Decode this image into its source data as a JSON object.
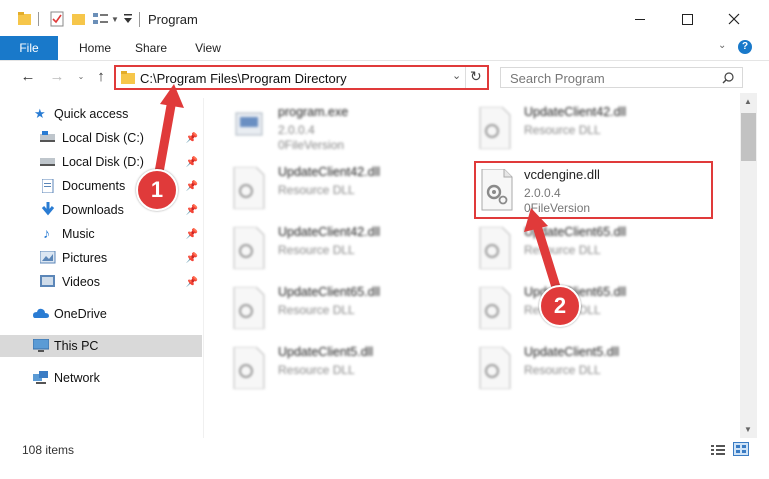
{
  "window": {
    "title": "Program"
  },
  "ribbon": {
    "tabs": [
      "File",
      "Home",
      "Share",
      "View"
    ]
  },
  "address": {
    "path": "C:\\Program Files\\Program Directory"
  },
  "search": {
    "placeholder": "Search Program"
  },
  "sidebar": {
    "items": [
      {
        "label": "Quick access",
        "icon": "star-icon"
      },
      {
        "label": "Local Disk (C:)",
        "icon": "drive-icon"
      },
      {
        "label": "Local Disk (D:)",
        "icon": "drive-icon"
      },
      {
        "label": "Documents",
        "icon": "documents-icon"
      },
      {
        "label": "Downloads",
        "icon": "download-icon"
      },
      {
        "label": "Music",
        "icon": "music-icon"
      },
      {
        "label": "Pictures",
        "icon": "pictures-icon"
      },
      {
        "label": "Videos",
        "icon": "videos-icon"
      },
      {
        "label": "OneDrive",
        "icon": "cloud-icon"
      },
      {
        "label": "This PC",
        "icon": "computer-icon"
      },
      {
        "label": "Network",
        "icon": "network-icon"
      }
    ]
  },
  "files": [
    {
      "name": "program.exe",
      "line2": "2.0.0.4",
      "line3": "0FileVersion"
    },
    {
      "name": "UpdateClient42.dll",
      "line2": "Resource DLL"
    },
    {
      "name": "UpdateClient42.dll",
      "line2": "Resource DLL"
    },
    {
      "name": "vcdengine.dll",
      "line2": "2.0.0.4",
      "line3": "0FileVersion"
    },
    {
      "name": "UpdateClient42.dll",
      "line2": "Resource DLL"
    },
    {
      "name": "UpdateClient65.dll",
      "line2": "Resource DLL"
    },
    {
      "name": "UpdateClient65.dll",
      "line2": "Resource DLL"
    },
    {
      "name": "UpdateClient65.dll",
      "line2": "Resource DLL"
    },
    {
      "name": "UpdateClient5.dll",
      "line2": "Resource DLL"
    },
    {
      "name": "UpdateClient5.dll",
      "line2": "Resource DLL"
    }
  ],
  "status": {
    "count": "108 items"
  },
  "annotations": {
    "step1": "1",
    "step2": "2"
  },
  "colors": {
    "accent": "#1979ca",
    "highlight": "#e03a3a"
  }
}
